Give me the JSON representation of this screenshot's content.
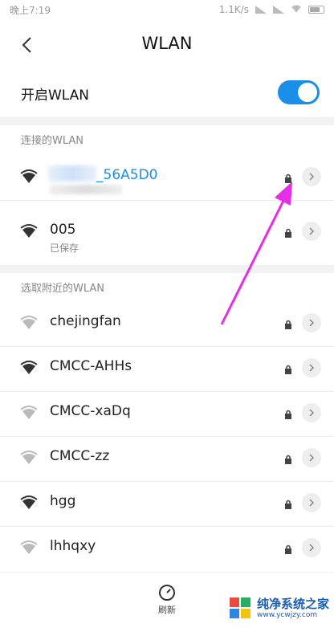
{
  "status_bar": {
    "time": "晚上7:19",
    "speed": "1.1K/s"
  },
  "header": {
    "title": "WLAN"
  },
  "toggle": {
    "label": "开启WLAN",
    "on": true
  },
  "connected_section": {
    "header": "连接的WLAN",
    "networks": [
      {
        "name": "_56A5D0",
        "sub": "",
        "locked": true,
        "connected": true
      },
      {
        "name": "005",
        "sub": "已保存",
        "locked": true,
        "connected": false
      }
    ]
  },
  "nearby_section": {
    "header": "选取附近的WLAN",
    "networks": [
      {
        "name": "chejingfan",
        "locked": true
      },
      {
        "name": "CMCC-AHHs",
        "locked": true
      },
      {
        "name": "CMCC-xaDq",
        "locked": true
      },
      {
        "name": "CMCC-zz",
        "locked": true
      },
      {
        "name": "hgg",
        "locked": true
      },
      {
        "name": "lhhqxy",
        "locked": true
      }
    ]
  },
  "bottom": {
    "refresh_label": "刷新"
  },
  "watermark": {
    "title": "纯净系统之家",
    "url": "www.ycwjzy.com"
  },
  "colors": {
    "accent": "#1a8fe8",
    "arrow": "#e62ee6"
  }
}
